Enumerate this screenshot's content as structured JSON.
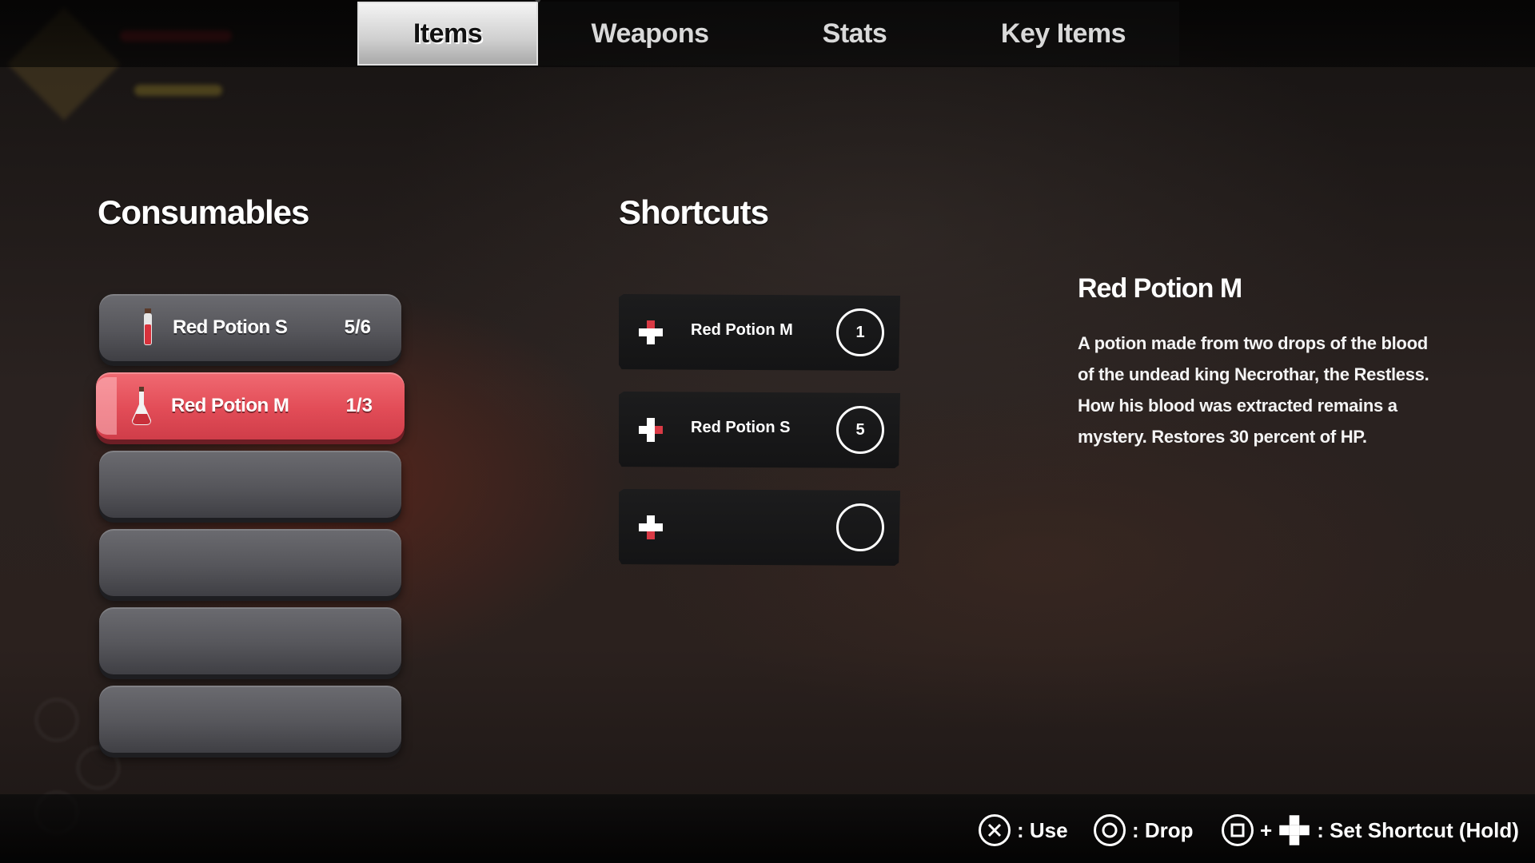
{
  "tabs": [
    {
      "label": "Items",
      "active": true
    },
    {
      "label": "Weapons",
      "active": false
    },
    {
      "label": "Stats",
      "active": false
    },
    {
      "label": "Key Items",
      "active": false
    }
  ],
  "consumables": {
    "title": "Consumables",
    "items": [
      {
        "name": "Red Potion S",
        "count": "5/6",
        "icon": "small-red-potion-icon",
        "selected": false
      },
      {
        "name": "Red Potion M",
        "count": "1/3",
        "icon": "medium-red-potion-icon",
        "selected": true
      },
      {
        "name": "",
        "count": "",
        "empty": true
      },
      {
        "name": "",
        "count": "",
        "empty": true
      },
      {
        "name": "",
        "count": "",
        "empty": true
      },
      {
        "name": "",
        "count": "",
        "empty": true
      }
    ]
  },
  "shortcuts": {
    "title": "Shortcuts",
    "items": [
      {
        "name": "Red Potion M",
        "number": "1",
        "icon": "dpad-icon"
      },
      {
        "name": "Red Potion S",
        "number": "5",
        "icon": "dpad-icon"
      },
      {
        "name": "",
        "number": "",
        "icon": "dpad-icon"
      }
    ]
  },
  "detail": {
    "title": "Red Potion M",
    "description": "A potion made from two drops of the blood of the undead king Necrothar, the Restless. How his blood was extracted remains a mystery. Restores 30 percent of HP."
  },
  "controls": {
    "use": {
      "button": "cross-button-icon",
      "label": ": Use"
    },
    "drop": {
      "button": "circle-button-icon",
      "label": ": Drop"
    },
    "shortcut": {
      "button": "square-button-icon",
      "plus": "+",
      "dpad": "dpad-icon",
      "label": ": Set Shortcut (Hold)"
    }
  },
  "colors": {
    "selected_slot": "#e24c57",
    "slot": "#56565b",
    "dpad_accent": "#d93a45"
  }
}
